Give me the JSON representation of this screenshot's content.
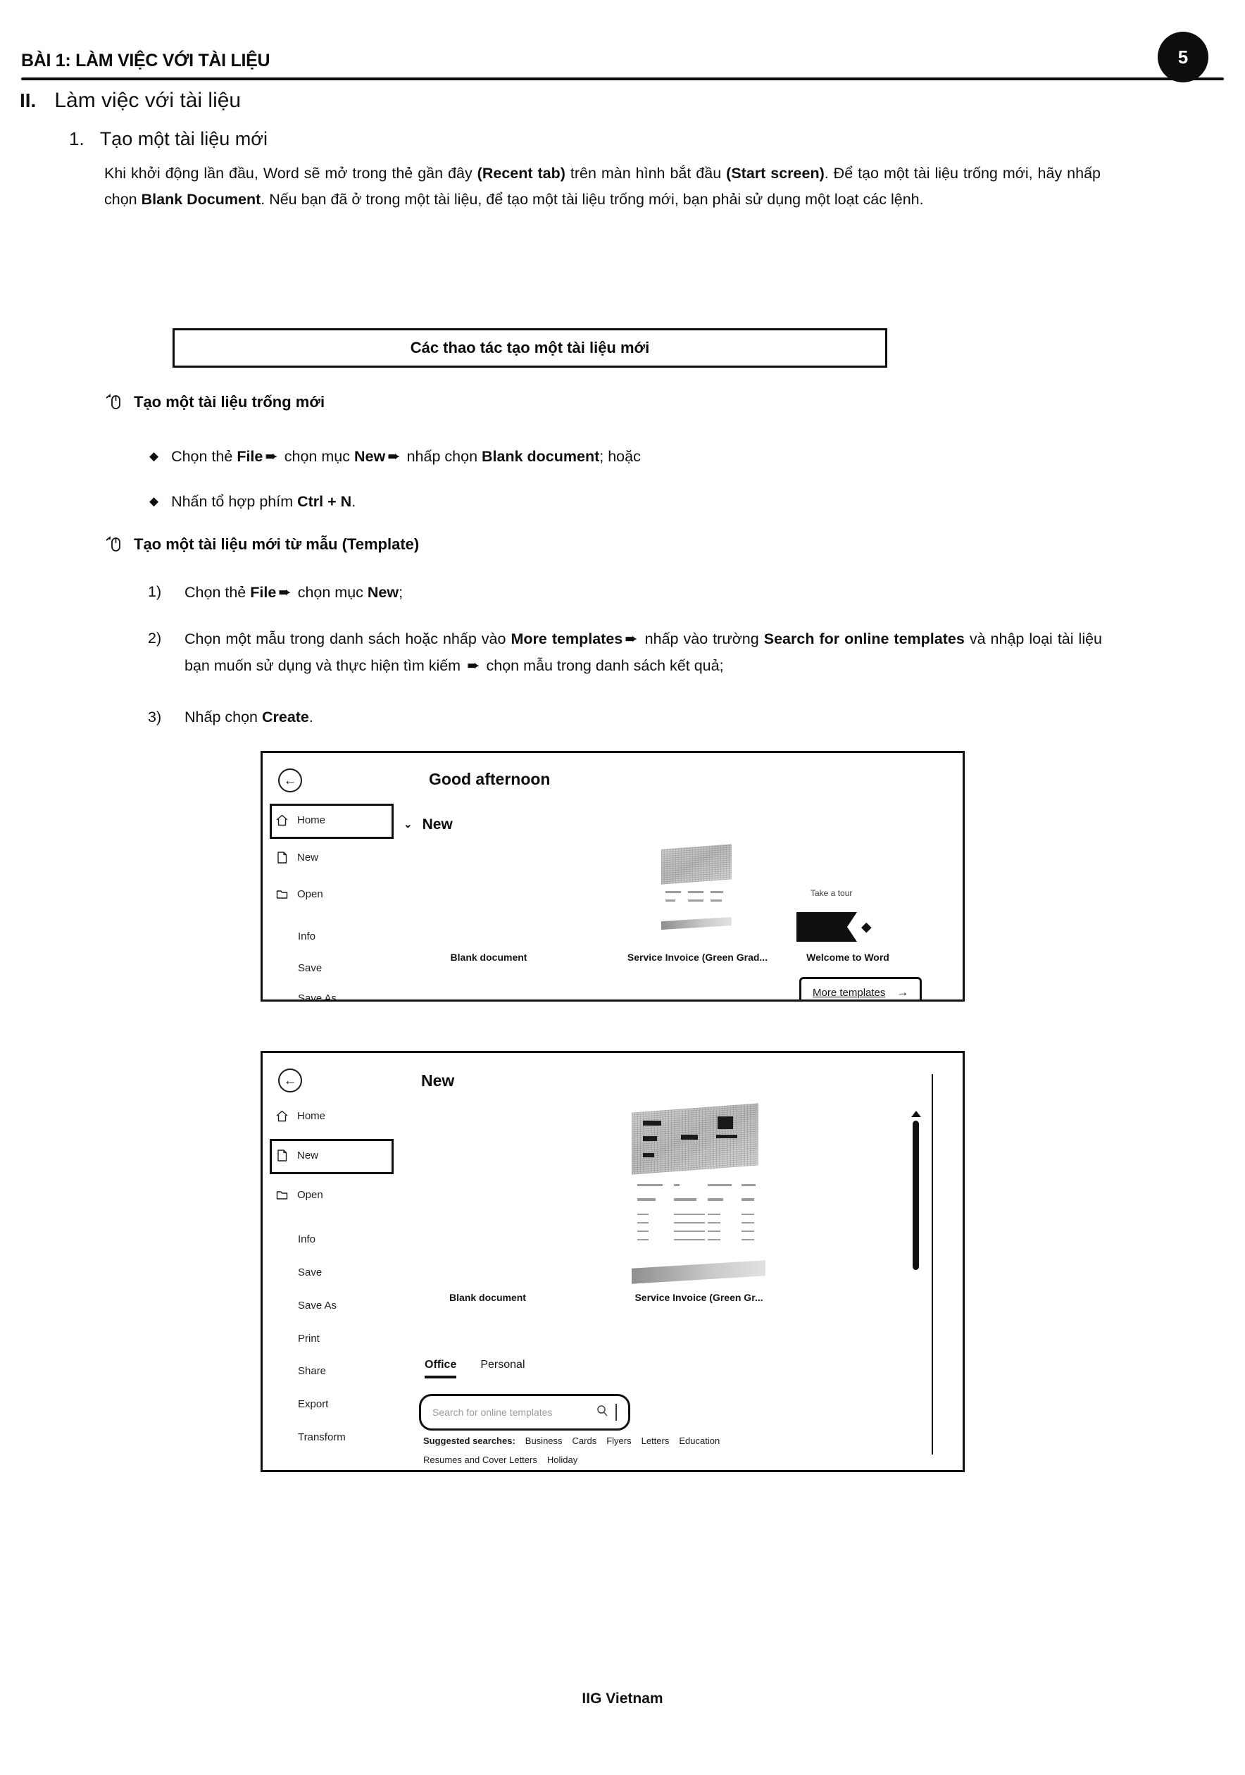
{
  "page": {
    "header_title": "BÀI 1: LÀM VIỆC VỚI TÀI LIỆU",
    "page_number": "5",
    "footer": "IIG Vietnam"
  },
  "section": {
    "number": "II.",
    "title": "Làm việc với tài liệu"
  },
  "subsection": {
    "number": "1.",
    "title": "Tạo một tài liệu mới"
  },
  "intro": {
    "part1": "Khi khởi động lần đầu, Word sẽ mở trong thẻ gần đây ",
    "bold1": "(Recent tab)",
    "part2": " trên màn hình bắt đầu ",
    "bold2": "(Start screen)",
    "part3": ". Để tạo một tài liệu trống mới, hãy nhấp chọn ",
    "bold3": "Blank Document",
    "part4": ". Nếu bạn đã ở trong một tài liệu, để tạo một tài liệu trống mới, bạn phải sử dụng một loạt các lệnh."
  },
  "box_title": "Các thao tác tạo một tài liệu mới",
  "block1": {
    "heading": "Tạo một tài liệu trống mới",
    "bullets": [
      {
        "p1": "Chọn thẻ ",
        "b1": "File",
        "arrow1": "➨",
        "p2": " chọn mục ",
        "b2": "New",
        "arrow2": "➨",
        "p3": " nhấp chọn ",
        "b3": "Blank document",
        "p4": "; hoặc"
      },
      {
        "p1": "Nhấn tổ hợp phím ",
        "b1": "Ctrl + N",
        "p2": "."
      }
    ]
  },
  "block2": {
    "heading": "Tạo một tài liệu mới từ mẫu (Template)",
    "items": [
      {
        "index": "1)",
        "p1": "Chọn thẻ ",
        "b1": "File",
        "arrow": "➨",
        "p2": " chọn mục ",
        "b2": "New",
        "p3": ";"
      },
      {
        "index": "2)",
        "p1": "Chọn một mẫu trong danh sách hoặc nhấp vào ",
        "b1": "More templates",
        "arrow1": "➨",
        "p2": " nhấp vào trường ",
        "b2": "Search for online templates",
        "p3": " và nhập loại tài liệu bạn muốn sử dụng và thực hiện tìm kiếm ",
        "arrow2": "➨",
        "p4": " chọn mẫu trong danh sách kết quả;"
      },
      {
        "index": "3)",
        "p1": "Nhấp chọn ",
        "b1": "Create",
        "p2": "."
      }
    ]
  },
  "screenshot_home": {
    "back_icon": "←",
    "greeting": "Good afternoon",
    "new_section_label": "New",
    "chevron": "⌄",
    "nav": [
      {
        "label": "Home",
        "icon": "home-icon",
        "selected": true
      },
      {
        "label": "New",
        "icon": "new-document-icon",
        "selected": false
      },
      {
        "label": "Open",
        "icon": "open-folder-icon",
        "selected": false
      },
      {
        "label": "Info",
        "icon": "",
        "selected": false
      },
      {
        "label": "Save",
        "icon": "",
        "selected": false
      },
      {
        "label": "Save As",
        "icon": "",
        "selected": false
      }
    ],
    "tiles": [
      {
        "caption": "Blank document"
      },
      {
        "caption": "Service Invoice (Green Grad..."
      },
      {
        "caption": "Welcome to Word",
        "overline": "Take a tour"
      }
    ],
    "more_templates": {
      "label": "More templates",
      "arrow": "→"
    }
  },
  "screenshot_new": {
    "back_icon": "←",
    "greeting": "New",
    "nav": [
      {
        "label": "Home",
        "icon": "home-icon",
        "selected": false
      },
      {
        "label": "New",
        "icon": "new-document-icon",
        "selected": true
      },
      {
        "label": "Open",
        "icon": "open-folder-icon",
        "selected": false
      },
      {
        "label": "Info",
        "icon": "",
        "selected": false
      },
      {
        "label": "Save",
        "icon": "",
        "selected": false
      },
      {
        "label": "Save As",
        "icon": "",
        "selected": false
      },
      {
        "label": "Print",
        "icon": "",
        "selected": false
      },
      {
        "label": "Share",
        "icon": "",
        "selected": false
      },
      {
        "label": "Export",
        "icon": "",
        "selected": false
      },
      {
        "label": "Transform",
        "icon": "",
        "selected": false
      }
    ],
    "tiles": [
      {
        "caption": "Blank document"
      },
      {
        "caption": "Service Invoice (Green Gr..."
      }
    ],
    "tabs": [
      {
        "label": "Office",
        "active": true
      },
      {
        "label": "Personal",
        "active": false
      }
    ],
    "search": {
      "placeholder": "Search for online templates",
      "magnifier": "⌕"
    },
    "suggested": {
      "lead": "Suggested searches:",
      "items_row1": [
        "Business",
        "Cards",
        "Flyers",
        "Letters",
        "Education"
      ],
      "items_row2": [
        "Resumes and Cover Letters",
        "Holiday"
      ]
    }
  }
}
